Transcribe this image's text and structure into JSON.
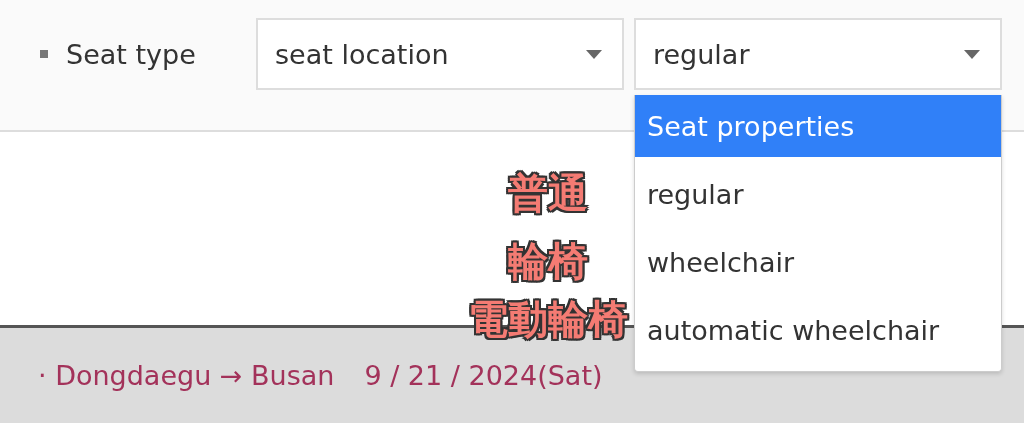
{
  "filter": {
    "label": "Seat type",
    "selects": [
      {
        "value": "seat location"
      },
      {
        "value": "regular"
      }
    ]
  },
  "dropdown": {
    "options": [
      {
        "label": "Seat properties",
        "selected": true
      },
      {
        "label": "regular",
        "selected": false
      },
      {
        "label": "wheelchair",
        "selected": false
      },
      {
        "label": "automatic wheelchair",
        "selected": false
      }
    ]
  },
  "route": {
    "trip": "· Dongdaegu → Busan",
    "date": "9 / 21 / 2024(Sat)"
  },
  "annotations": [
    "普通",
    "輪椅",
    "電動輪椅"
  ]
}
